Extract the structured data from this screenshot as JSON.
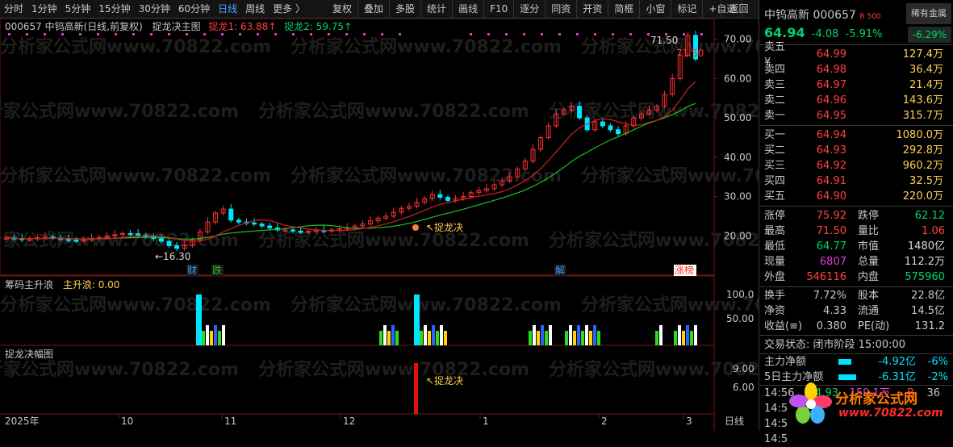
{
  "toolbar": {
    "periods": [
      "分时",
      "1分钟",
      "5分钟",
      "15分钟",
      "30分钟",
      "60分钟",
      "日线",
      "周线",
      "更多 〉"
    ],
    "active_period": "日线",
    "buttons": [
      "复权",
      "叠加",
      "多股",
      "统计",
      "画线",
      "F10",
      "逐分",
      "同资",
      "开资",
      "简框",
      "小窗",
      "标记",
      "+自选"
    ],
    "back": "返回"
  },
  "chart_header": {
    "code_title": "000657 中钨高新(日线,前复权)",
    "indicator_name": "捉龙决主图",
    "line1_label": "捉龙1: 63.88↑",
    "line2_label": "捉龙2: 59.75↑"
  },
  "price_axis": [
    "70.00",
    "60.00",
    "50.00",
    "40.00",
    "30.00",
    "20.00"
  ],
  "annotations": {
    "high": "71.50",
    "high2": "71.50",
    "low": "←16.30",
    "signal": "↖捉龙决",
    "tags": [
      "财",
      "跌",
      "解",
      "涨榜"
    ]
  },
  "sub1": {
    "title": "筹码主升浪",
    "value_label": "主升浪: 0.00",
    "axis": [
      "100.0",
      "50.00"
    ]
  },
  "sub2": {
    "title": "捉龙决幅图",
    "axis": [
      "9.00",
      "6.00"
    ],
    "signal": "↖捉龙决"
  },
  "time_axis": [
    "2025年",
    "10",
    "11",
    "12",
    "1",
    "2",
    "3"
  ],
  "time_axis_right": "日线",
  "watermark": "分析家公式网www.70822.com",
  "quote": {
    "name": "中钨高新",
    "code": "000657",
    "badge": "R 500",
    "tag": "稀有金属",
    "tag_change": "-6.29%",
    "price": "64.94",
    "change": "-4.08",
    "change_pct": "-5.91%"
  },
  "sells": [
    {
      "label": "卖五 ¥",
      "price": "64.99",
      "vol": "127.4万"
    },
    {
      "label": "卖四",
      "price": "64.98",
      "vol": "36.4万"
    },
    {
      "label": "卖三",
      "price": "64.97",
      "vol": "21.4万"
    },
    {
      "label": "卖二",
      "price": "64.96",
      "vol": "143.6万"
    },
    {
      "label": "卖一",
      "price": "64.95",
      "vol": "315.7万"
    }
  ],
  "buys": [
    {
      "label": "买一",
      "price": "64.94",
      "vol": "1080.0万"
    },
    {
      "label": "买二",
      "price": "64.93",
      "vol": "292.8万"
    },
    {
      "label": "买三",
      "price": "64.92",
      "vol": "960.2万"
    },
    {
      "label": "买四",
      "price": "64.91",
      "vol": "32.5万"
    },
    {
      "label": "买五",
      "price": "64.90",
      "vol": "220.0万"
    }
  ],
  "stats": [
    {
      "l1": "涨停",
      "v1": "75.92",
      "c1": "red",
      "l2": "跌停",
      "v2": "62.12",
      "c2": "green"
    },
    {
      "l1": "最高",
      "v1": "71.50",
      "c1": "red",
      "l2": "量比",
      "v2": "1.06",
      "c2": "red"
    },
    {
      "l1": "最低",
      "v1": "64.77",
      "c1": "green",
      "l2": "市值",
      "v2": "1480亿",
      "c2": "white"
    },
    {
      "l1": "现量",
      "v1": "6807",
      "c1": "purple",
      "l2": "总量",
      "v2": "112.2万",
      "c2": "white"
    },
    {
      "l1": "外盘",
      "v1": "546116",
      "c1": "red",
      "l2": "内盘",
      "v2": "575960",
      "c2": "green"
    }
  ],
  "stats2": [
    {
      "l1": "换手",
      "v1": "7.72%",
      "l2": "股本",
      "v2": "22.8亿"
    },
    {
      "l1": "净资",
      "v1": "4.33",
      "l2": "流通",
      "v2": "14.5亿"
    },
    {
      "l1": "收益(≡)",
      "v1": "0.380",
      "l2": "PE(动)",
      "v2": "131.2"
    }
  ],
  "trade_status": "交易状态: 闭市阶段 15:00:00",
  "flows": [
    {
      "label": "主力净额",
      "value": "-4.92亿",
      "pct": "-6%"
    },
    {
      "label": "5日主力净额",
      "value": "-6.31亿",
      "pct": "-2%"
    }
  ],
  "ticks": [
    {
      "time": "14:56",
      "price": "64.93",
      "vol": "159.1万",
      "side": "B",
      "n": "36"
    },
    {
      "time": "14:5",
      "price": "",
      "vol": "",
      "side": "",
      "n": ""
    },
    {
      "time": "14:5",
      "price": "",
      "vol": "",
      "side": "",
      "n": ""
    },
    {
      "time": "14:5",
      "price": "",
      "vol": "",
      "side": "",
      "n": ""
    }
  ],
  "logo": {
    "line1": "分析家公式网",
    "line2": "www.70822.com"
  },
  "chart_data": {
    "type": "line",
    "series_candles_close": [
      19.5,
      19.3,
      19.0,
      19.2,
      19.5,
      19.7,
      19.4,
      19.1,
      18.9,
      18.8,
      19.0,
      19.3,
      19.6,
      20.0,
      20.3,
      20.6,
      20.5,
      20.2,
      19.8,
      19.3,
      18.6,
      17.5,
      16.8,
      17.5,
      19.0,
      21.0,
      23.5,
      25.8,
      26.8,
      24.0,
      23.5,
      23.3,
      23.0,
      22.5,
      22.0,
      21.5,
      21.5,
      21.2,
      21.0,
      21.2,
      21.4,
      21.3,
      21.5,
      21.8,
      22.0,
      22.5,
      23.0,
      23.8,
      24.5,
      25.0,
      26.0,
      27.0,
      27.5,
      28.5,
      29.5,
      30.5,
      29.8,
      29.0,
      29.5,
      30.0,
      31.0,
      31.5,
      32.0,
      33.0,
      34.0,
      35.0,
      37.0,
      39.0,
      42.0,
      45.0,
      48.0,
      51.0,
      52.0,
      53.0,
      50.0,
      47.0,
      49.0,
      48.0,
      47.0,
      46.0,
      48.0,
      50.0,
      51.0,
      52.0,
      53.0,
      56.0,
      60.0,
      66.0,
      71.0,
      65.0
    ],
    "ylim": [
      15,
      75
    ]
  }
}
